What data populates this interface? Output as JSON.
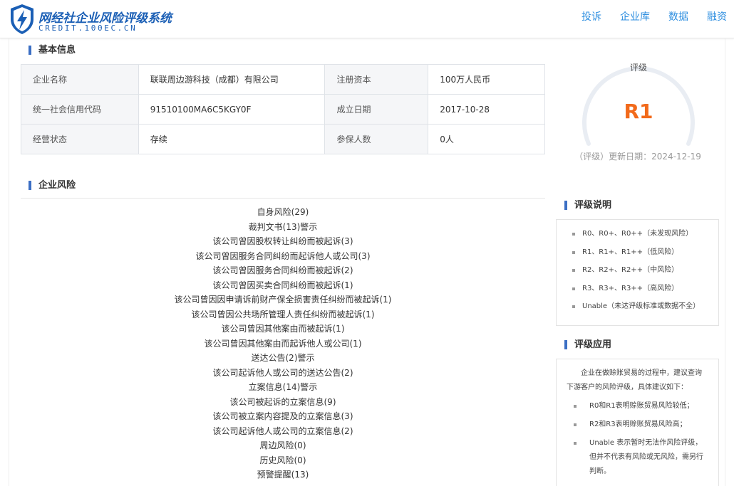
{
  "header": {
    "brand_cn": "网经社企业风险评级系统",
    "brand_en": "CREDIT.100EC.CN",
    "brand_color": "#1b5fb5",
    "nav": [
      "投诉",
      "企业库",
      "数据",
      "融资"
    ]
  },
  "basic_info": {
    "title": "基本信息",
    "rows": [
      [
        {
          "label": "企业名称",
          "value": "联联周边游科技（成都）有限公司"
        },
        {
          "label": "注册资本",
          "value": "100万人民币"
        }
      ],
      [
        {
          "label": "统一社会信用代码",
          "value": "91510100MA6C5KGY0F"
        },
        {
          "label": "成立日期",
          "value": "2017-10-28"
        }
      ],
      [
        {
          "label": "经营状态",
          "value": "存续"
        },
        {
          "label": "参保人数",
          "value": "0人"
        }
      ]
    ]
  },
  "rating": {
    "label": "评级",
    "grade": "R1",
    "grade_color": "#f26a1b",
    "update": "（评级）更新日期：2024-12-19"
  },
  "risk": {
    "title": "企业风险",
    "items": [
      "自身风险(29)",
      "裁判文书(13)警示",
      "该公司曾因股权转让纠纷而被起诉(3)",
      "该公司曾因服务合同纠纷而起诉他人或公司(3)",
      "该公司曾因服务合同纠纷而被起诉(2)",
      "该公司曾因买卖合同纠纷而被起诉(1)",
      "该公司曾因因申请诉前财产保全损害责任纠纷而被起诉(1)",
      "该公司曾因公共场所管理人责任纠纷而被起诉(1)",
      "该公司曾因其他案由而被起诉(1)",
      "该公司曾因其他案由而起诉他人或公司(1)",
      "送达公告(2)警示",
      "该公司起诉他人或公司的送达公告(2)",
      "立案信息(14)警示",
      "该公司被起诉的立案信息(9)",
      "该公司被立案内容提及的立案信息(3)",
      "该公司起诉他人或公司的立案信息(2)",
      "周边风险(0)",
      "历史风险(0)",
      "预警提醒(13)"
    ]
  },
  "rating_legend": {
    "title": "评级说明",
    "items": [
      "R0、R0+、R0++（未发现风险）",
      "R1、R1+、R1++（低风险）",
      "R2、R2+、R2++（中风险）",
      "R3、R3+、R3++（高风险）",
      "Unable（未达评级标准或数据不全）"
    ]
  },
  "rating_application": {
    "title": "评级应用",
    "intro": "企业在做赊账贸易的过程中，建议查询下游客户的风险评级，具体建议如下：",
    "items": [
      "R0和R1表明赊账贸易风险较低；",
      "R2和R3表明赊账贸易风险高；",
      "Unable 表示暂时无法作风险评级，但并不代表有风险或无风险，需另行判断。"
    ]
  }
}
